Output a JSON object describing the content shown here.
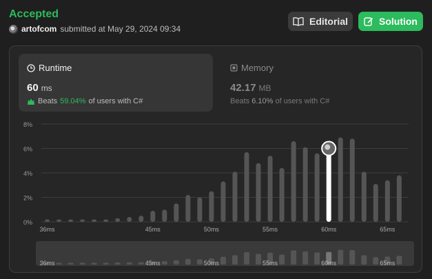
{
  "header": {
    "status": "Accepted",
    "username": "artofcom",
    "submitted_text": "submitted at May 29, 2024 09:34"
  },
  "buttons": {
    "editorial_label": "Editorial",
    "solution_label": "Solution"
  },
  "runtime": {
    "title": "Runtime",
    "value": "60",
    "unit": "ms",
    "beats_label": "Beats",
    "beats_pct": "59.04%",
    "beats_suffix": "of users with C#"
  },
  "memory": {
    "title": "Memory",
    "value": "42.17",
    "unit": "MB",
    "beats_label": "Beats",
    "beats_pct": "6.10%",
    "beats_suffix": "of users with C#"
  },
  "colors": {
    "accent_green": "#2cbb5d",
    "bar_gray": "#555555",
    "bar_highlight": "#ffffff"
  },
  "chart_data": {
    "type": "bar",
    "x": [
      35.5,
      36,
      36.5,
      37,
      37.5,
      38,
      38.5,
      39,
      39.5,
      40,
      40.5,
      41,
      41.5,
      42,
      42.5,
      43,
      43.5,
      44,
      44.5,
      45,
      45.5,
      46,
      46.5,
      47,
      47.5,
      48,
      48.5,
      49,
      49.5,
      50,
      50.5,
      51,
      51.5,
      52,
      52.5,
      53,
      53.5,
      54,
      54.5,
      55,
      55.5,
      56,
      56.5,
      57,
      57.5,
      58,
      58.5,
      59,
      59.5,
      60,
      60.5,
      61,
      61.5,
      62,
      62.5,
      63,
      63.5,
      64,
      64.5,
      65,
      65.5,
      66,
      66.5,
      67,
      67.5,
      68,
      68.5,
      69,
      69.5,
      70
    ],
    "bars": [
      {
        "x": 36,
        "value": 0.2
      },
      {
        "x": 37,
        "value": 0.2
      },
      {
        "x": 38,
        "value": 0.2
      },
      {
        "x": 39,
        "value": 0.2
      },
      {
        "x": 40,
        "value": 0.2
      },
      {
        "x": 41,
        "value": 0.2
      },
      {
        "x": 42,
        "value": 0.3
      },
      {
        "x": 43,
        "value": 0.4
      },
      {
        "x": 44,
        "value": 0.5
      },
      {
        "x": 45,
        "value": 0.9
      },
      {
        "x": 46,
        "value": 1.0
      },
      {
        "x": 47,
        "value": 1.5
      },
      {
        "x": 48,
        "value": 2.2
      },
      {
        "x": 49,
        "value": 2.0
      },
      {
        "x": 50,
        "value": 2.5
      },
      {
        "x": 51,
        "value": 3.3
      },
      {
        "x": 52,
        "value": 4.1
      },
      {
        "x": 53,
        "value": 5.7
      },
      {
        "x": 54,
        "value": 4.8
      },
      {
        "x": 55,
        "value": 5.4
      },
      {
        "x": 56,
        "value": 4.4
      },
      {
        "x": 57,
        "value": 6.6
      },
      {
        "x": 58,
        "value": 6.1
      },
      {
        "x": 59,
        "value": 5.6
      },
      {
        "x": 60,
        "value": 5.8
      },
      {
        "x": 61,
        "value": 6.9
      },
      {
        "x": 62,
        "value": 6.8
      },
      {
        "x": 63,
        "value": 4.1
      },
      {
        "x": 64,
        "value": 3.1
      },
      {
        "x": 65,
        "value": 3.4
      },
      {
        "x": 66,
        "value": 3.8
      }
    ],
    "highlight_x": 60,
    "x_ticks": [
      36,
      45,
      50,
      55,
      60,
      65
    ],
    "x_tick_labels": [
      "36ms",
      "45ms",
      "50ms",
      "55ms",
      "60ms",
      "65ms"
    ],
    "y_ticks": [
      0,
      2,
      4,
      6,
      8
    ],
    "y_tick_labels": [
      "0%",
      "2%",
      "4%",
      "6%",
      "8%"
    ],
    "ylim": [
      0,
      8
    ],
    "grid": true
  }
}
